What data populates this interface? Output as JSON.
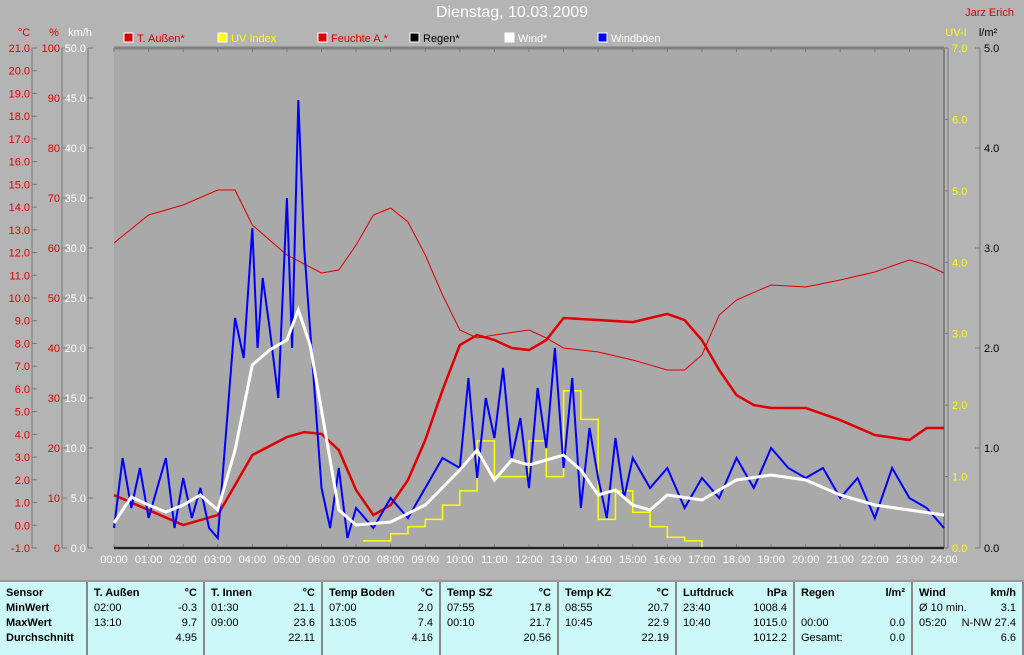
{
  "title": "Dienstag, 10.03.2009",
  "author": "Jarz Erich",
  "chart_data": {
    "type": "line",
    "title": "Dienstag, 10.03.2009",
    "xlabel": "",
    "x_ticks": [
      "00:00",
      "01:00",
      "02:00",
      "03:00",
      "04:00",
      "05:00",
      "06:00",
      "07:00",
      "08:00",
      "09:00",
      "10:00",
      "11:00",
      "12:00",
      "13:00",
      "14:00",
      "15:00",
      "16:00",
      "17:00",
      "18:00",
      "19:00",
      "20:00",
      "21:00",
      "22:00",
      "23:00",
      "24:00"
    ],
    "xlim": [
      0,
      24
    ],
    "axes": [
      {
        "id": "temp",
        "unit": "°C",
        "range": [
          -1,
          21
        ],
        "step": 1,
        "decimals": 1,
        "color": "#e00000",
        "side": "left"
      },
      {
        "id": "hum",
        "unit": "%",
        "range": [
          0,
          100
        ],
        "step": 10,
        "decimals": 0,
        "color": "#e00000",
        "side": "left"
      },
      {
        "id": "kmh",
        "unit": "km/h",
        "range": [
          0,
          50
        ],
        "step": 5,
        "decimals": 1,
        "color": "#ffffff",
        "side": "left"
      },
      {
        "id": "uv",
        "unit": "UV-I",
        "range": [
          0,
          7
        ],
        "step": 1,
        "decimals": 1,
        "color": "#ffff00",
        "side": "right"
      },
      {
        "id": "rain",
        "unit": "l/m²",
        "range": [
          0,
          5
        ],
        "step": 1,
        "decimals": 1,
        "color": "#000000",
        "side": "right"
      }
    ],
    "legend_position": "top",
    "series": [
      {
        "name": "T. Außen*",
        "axis": "temp",
        "color": "#e00000",
        "width": 2.5,
        "x": [
          0,
          1,
          2,
          3,
          4,
          5,
          5.5,
          6,
          6.5,
          7,
          7.5,
          8,
          8.5,
          9,
          9.5,
          10,
          10.5,
          11,
          11.5,
          12,
          12.5,
          13,
          14,
          15,
          16,
          16.5,
          17,
          17.5,
          18,
          18.5,
          19,
          20,
          21,
          22,
          23,
          23.5,
          24
        ],
        "y": [
          1.33,
          0.67,
          0.01,
          0.45,
          3.09,
          3.88,
          4.1,
          4.02,
          3.31,
          1.55,
          0.45,
          0.89,
          1.99,
          3.75,
          5.95,
          7.93,
          8.37,
          8.15,
          7.8,
          7.71,
          8.15,
          9.12,
          9.03,
          8.94,
          9.3,
          9.03,
          8.15,
          6.83,
          5.73,
          5.29,
          5.16,
          5.16,
          4.63,
          3.97,
          3.75,
          4.28,
          4.28
        ]
      },
      {
        "name": "UV Index",
        "axis": "uv",
        "color": "#ffff00",
        "width": 1.5,
        "step": true,
        "x": [
          7.2,
          8,
          8.5,
          9,
          9.5,
          10,
          10.5,
          11,
          11.5,
          12,
          12.5,
          13,
          13.5,
          14,
          14.5,
          15,
          15.5,
          16,
          16.5,
          17
        ],
        "y": [
          0.1,
          0.2,
          0.3,
          0.4,
          0.6,
          0.8,
          1.5,
          1.0,
          1.0,
          1.5,
          1.0,
          2.2,
          1.8,
          0.4,
          0.8,
          0.5,
          0.3,
          0.15,
          0.1,
          0
        ]
      },
      {
        "name": "Feuchte A.*",
        "axis": "hum",
        "color": "#e00000",
        "width": 1,
        "x": [
          0,
          1,
          2,
          3,
          3.5,
          4,
          5,
          6,
          6.5,
          7,
          7.5,
          8,
          8.5,
          9,
          9.5,
          10,
          10.5,
          11,
          12,
          12.5,
          13,
          14,
          15,
          16,
          16.5,
          17,
          17.5,
          18,
          19,
          20,
          21,
          22,
          23,
          23.5,
          24
        ],
        "y": [
          61,
          66.6,
          68.6,
          71.6,
          71.6,
          64.6,
          58.6,
          55,
          55.6,
          60.6,
          66.6,
          68,
          65.2,
          58.6,
          50.6,
          43.6,
          42,
          42.6,
          43.6,
          42,
          40,
          39.2,
          37.6,
          35.6,
          35.6,
          38.6,
          46.6,
          49.6,
          52.6,
          52.2,
          53.6,
          55.2,
          57.6,
          56.6,
          55
        ]
      },
      {
        "name": "Regen*",
        "axis": "rain",
        "color": "#000000",
        "width": 1.5,
        "x": [
          0,
          24
        ],
        "y": [
          0,
          0
        ]
      },
      {
        "name": "Wind*",
        "axis": "kmh",
        "color": "#ffffff",
        "width": 3,
        "x": [
          0,
          0.5,
          1,
          1.5,
          2,
          2.5,
          3,
          3.5,
          4,
          4.5,
          5,
          5.33,
          5.67,
          6,
          6.5,
          7,
          8,
          9,
          10,
          10.5,
          11,
          11.5,
          12,
          12.5,
          13,
          13.5,
          14,
          14.5,
          15,
          15.5,
          16,
          17,
          18,
          19,
          20,
          21,
          22,
          23,
          24
        ],
        "y": [
          2.5,
          5.1,
          4.3,
          3.6,
          4.3,
          5.3,
          3.8,
          9.8,
          18.3,
          19.8,
          20.8,
          23.8,
          20.3,
          13.8,
          3.8,
          2.3,
          2.6,
          4.3,
          7.8,
          9.8,
          6.8,
          8.8,
          8.3,
          8.8,
          9.3,
          7.8,
          5.3,
          5.8,
          4.3,
          3.8,
          5.3,
          4.8,
          6.8,
          7.3,
          6.8,
          5.3,
          4.3,
          3.8,
          3.3
        ]
      },
      {
        "name": "Windböen",
        "axis": "kmh",
        "color": "#0000ff",
        "width": 2,
        "x": [
          0,
          0.25,
          0.5,
          0.75,
          1,
          1.25,
          1.5,
          1.75,
          2,
          2.25,
          2.5,
          2.75,
          3,
          3.25,
          3.5,
          3.75,
          4,
          4.15,
          4.3,
          4.5,
          4.75,
          5,
          5.15,
          5.33,
          5.5,
          5.75,
          6,
          6.25,
          6.5,
          6.75,
          7,
          7.5,
          8,
          8.5,
          9,
          9.5,
          10,
          10.25,
          10.5,
          10.75,
          11,
          11.25,
          11.5,
          11.75,
          12,
          12.25,
          12.5,
          12.75,
          13,
          13.25,
          13.5,
          13.75,
          14,
          14.25,
          14.5,
          14.75,
          15,
          15.5,
          16,
          16.5,
          17,
          17.5,
          18,
          18.5,
          19,
          19.5,
          20,
          20.5,
          21,
          21.5,
          22,
          22.5,
          23,
          23.5,
          24
        ],
        "y": [
          2,
          9,
          4,
          8,
          3,
          6,
          9,
          2,
          7,
          3,
          6,
          2,
          1,
          12,
          23,
          19,
          32,
          20,
          27,
          22,
          15,
          35,
          20,
          44.8,
          30,
          18,
          6,
          2,
          8,
          1,
          4,
          2,
          5,
          3,
          6,
          9,
          8,
          17,
          7,
          15,
          11,
          18,
          9,
          13,
          6,
          16,
          10,
          20,
          8,
          17,
          4,
          12,
          7,
          3,
          11,
          5,
          9,
          6,
          8,
          4,
          7,
          5,
          9,
          6,
          10,
          8,
          7,
          8,
          5,
          7,
          3,
          8,
          5,
          4,
          2
        ]
      }
    ]
  },
  "table": {
    "columns": [
      {
        "head": [
          "Sensor",
          ""
        ],
        "rows": [
          [
            "MinWert",
            ""
          ],
          [
            "MaxWert",
            ""
          ],
          [
            "Durchschnitt",
            ""
          ]
        ]
      },
      {
        "head": [
          "T. Außen",
          "°C"
        ],
        "rows": [
          [
            "02:00",
            "-0.3"
          ],
          [
            "13:10",
            "9.7"
          ],
          [
            "",
            "4.95"
          ]
        ]
      },
      {
        "head": [
          "T. Innen",
          "°C"
        ],
        "rows": [
          [
            "01:30",
            "21.1"
          ],
          [
            "09:00",
            "23.6"
          ],
          [
            "",
            "22.11"
          ]
        ]
      },
      {
        "head": [
          "Temp Boden",
          "°C"
        ],
        "rows": [
          [
            "07:00",
            "2.0"
          ],
          [
            "13:05",
            "7.4"
          ],
          [
            "",
            "4.16"
          ]
        ]
      },
      {
        "head": [
          "Temp SZ",
          "°C"
        ],
        "rows": [
          [
            "07:55",
            "17.8"
          ],
          [
            "00:10",
            "21.7"
          ],
          [
            "",
            "20.56"
          ]
        ]
      },
      {
        "head": [
          "Temp KZ",
          "°C"
        ],
        "rows": [
          [
            "08:55",
            "20.7"
          ],
          [
            "10:45",
            "22.9"
          ],
          [
            "",
            "22.19"
          ]
        ]
      },
      {
        "head": [
          "Luftdruck",
          "hPa"
        ],
        "rows": [
          [
            "23:40",
            "1008.4"
          ],
          [
            "10:40",
            "1015.0"
          ],
          [
            "",
            "1012.2"
          ]
        ]
      },
      {
        "head": [
          "Regen",
          "l/m²"
        ],
        "rows": [
          [
            "",
            ""
          ],
          [
            "00:00",
            "0.0"
          ],
          [
            "Gesamt:",
            "0.0"
          ]
        ]
      },
      {
        "head": [
          "Wind",
          "km/h"
        ],
        "rows": [
          [
            "Ø 10 min.",
            "3.1"
          ],
          [
            "05:20",
            "N-NW 27.4"
          ],
          [
            "",
            "6.6"
          ]
        ]
      }
    ]
  }
}
